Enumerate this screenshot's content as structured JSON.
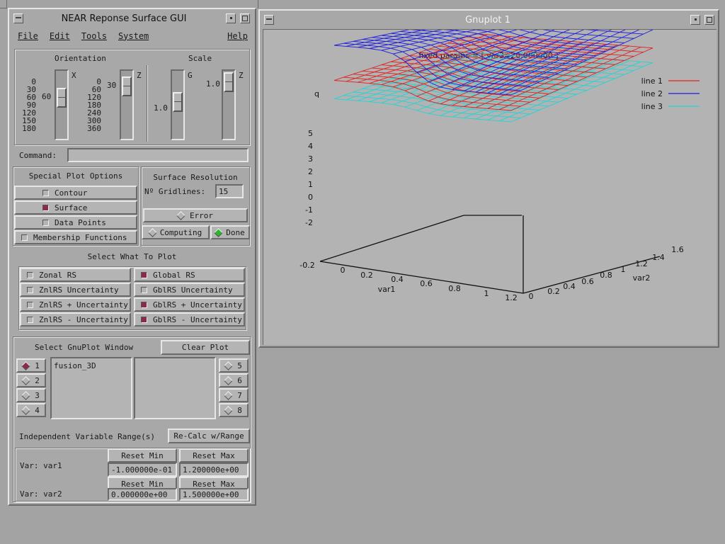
{
  "gui": {
    "title": "NEAR Reponse Surface GUI",
    "menu": {
      "file": "File",
      "edit": "Edit",
      "tools": "Tools",
      "system": "System",
      "help": "Help"
    },
    "orientation": {
      "label": "Orientation",
      "x_label": "X",
      "z_label": "Z",
      "x_ticks": [
        "0",
        "30",
        "60",
        "90",
        "120",
        "150",
        "180"
      ],
      "z_ticks": [
        "0",
        "60",
        "120",
        "180",
        "240",
        "300",
        "360"
      ],
      "x_value": "60",
      "z_value": "30"
    },
    "scale": {
      "label": "Scale",
      "g_label": "G",
      "z_label": "Z",
      "g_value": "1.0",
      "z_value": "1.0"
    },
    "command_label": "Command:",
    "command_value": "",
    "special": {
      "title": "Special Plot Options",
      "options": [
        {
          "label": "Contour",
          "checked": false
        },
        {
          "label": "Surface",
          "checked": true
        },
        {
          "label": "Data Points",
          "checked": false
        },
        {
          "label": "Membership Functions",
          "checked": false
        }
      ]
    },
    "resolution": {
      "title": "Surface Resolution",
      "gridlines_label": "Nº Gridlines:",
      "gridlines_value": "15",
      "error_label": "Error",
      "computing_label": "Computing",
      "done_label": "Done"
    },
    "select_title": "Select What To Plot",
    "plot_options": {
      "left": [
        {
          "label": "Zonal RS",
          "checked": false
        },
        {
          "label": "ZnlRS Uncertainty",
          "checked": false
        },
        {
          "label": "ZnlRS + Uncertainty",
          "checked": false
        },
        {
          "label": "ZnlRS - Uncertainty",
          "checked": false
        }
      ],
      "right": [
        {
          "label": "Global RS",
          "checked": true
        },
        {
          "label": "GblRS Uncertainty",
          "checked": false
        },
        {
          "label": "GblRS + Uncertainty",
          "checked": true
        },
        {
          "label": "GblRS - Uncertainty",
          "checked": true
        }
      ]
    },
    "gnuplot_select": {
      "title": "Select GnuPlot Window",
      "clear_label": "Clear Plot",
      "left_windows": [
        "1",
        "2",
        "3",
        "4"
      ],
      "right_windows": [
        "5",
        "6",
        "7",
        "8"
      ],
      "selected": "1",
      "list_item": "fusion_3D"
    },
    "range": {
      "title": "Independent Variable Range(s)",
      "recalc_label": "Re-Calc w/Range",
      "reset_min_label": "Reset Min",
      "reset_max_label": "Reset Max",
      "var1_label": "Var: var1",
      "var2_label": "Var: var2",
      "var1_min": "-1.000000e-01",
      "var1_max": "1.200000e+00",
      "var2_min": "0.000000e+00",
      "var2_max": "1.500000e+00"
    }
  },
  "gnuplot": {
    "title": "Gnuplot 1",
    "fixed_params": "fixed params = [ var3=20,000000 ]",
    "q_label": "q",
    "xlabel": "var1",
    "ylabel": "var2",
    "z_ticks": [
      "5",
      "4",
      "3",
      "2",
      "1",
      "0",
      "-1",
      "-2"
    ],
    "x_ticks": [
      "-0.2",
      "0",
      "0.2",
      "0.4",
      "0.6",
      "0.8",
      "1",
      "1.2"
    ],
    "y_ticks": [
      "0",
      "0.2",
      "0.4",
      "0.6",
      "0.8",
      "1",
      "1.2",
      "1.4",
      "1.6"
    ],
    "legend": [
      {
        "name": "line 1",
        "color": "#e02020"
      },
      {
        "name": "line 2",
        "color": "#1d1de0"
      },
      {
        "name": "line 3",
        "color": "#25d4d4"
      }
    ]
  }
}
